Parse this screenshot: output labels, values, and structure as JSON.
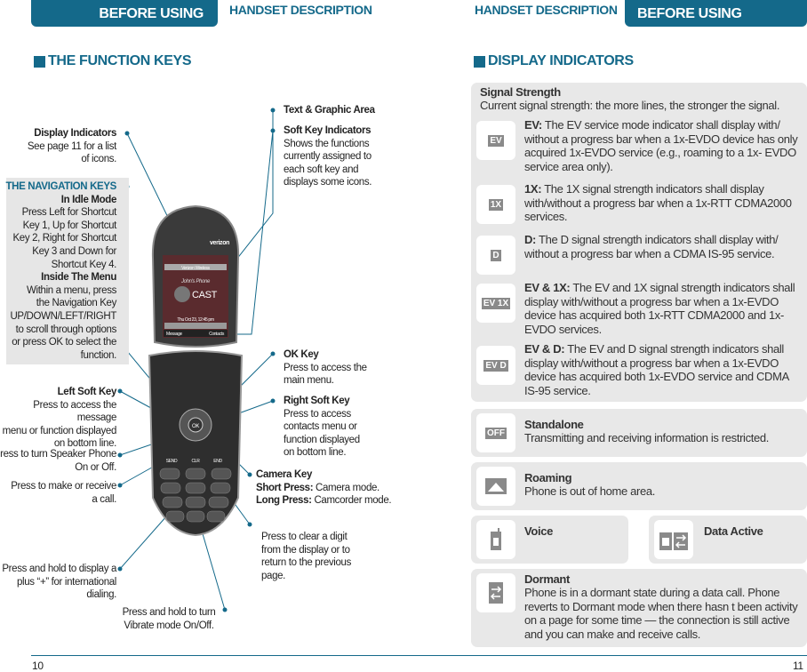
{
  "header": {
    "left_tab": "BEFORE USING",
    "left_section": "HANDSET DESCRIPTION",
    "right_section": "HANDSET DESCRIPTION",
    "right_tab": "BEFORE USING",
    "accent_color": "#14698a"
  },
  "left_page": {
    "title": "THE FUNCTION KEYS",
    "display_indicators": {
      "title": "Display Indicators",
      "lines": [
        "See page 11 for a list",
        "of icons."
      ]
    },
    "nav_keys": {
      "title": "THE NAVIGATION KEYS",
      "idle_title": "In Idle Mode",
      "idle_lines": [
        "Press Left for Shortcut",
        "Key 1, Up for Shortcut",
        "Key 2, Right for Shortcut",
        "Key 3 and Down for",
        "Shortcut Key 4."
      ],
      "menu_title": "Inside The Menu",
      "menu_lines": [
        "Within a menu, press",
        "the Navigation Key",
        "UP/DOWN/LEFT/RIGHT",
        "to scroll through options",
        "or press OK to select the",
        "function."
      ]
    },
    "left_soft_key": {
      "title": "Left Soft Key",
      "lines": [
        "Press to access the message",
        "menu or function displayed",
        "on bottom line."
      ]
    },
    "speaker": [
      "Press to turn Speaker Phone",
      "On or Off."
    ],
    "send": [
      "Press to make or receive",
      "a call."
    ],
    "plus": [
      "Press and hold to display a",
      "plus “+” for international",
      "dialing."
    ],
    "vibrate": [
      "Press and hold to turn",
      "Vibrate mode On/Off."
    ],
    "text_graphic": "Text & Graphic Area",
    "soft_key_indicators": {
      "title": "Soft Key Indicators",
      "lines": [
        "Shows the functions",
        "currently assigned to",
        "each soft key and",
        "displays some icons."
      ]
    },
    "ok_key": {
      "title": "OK Key",
      "lines": [
        "Press to access the",
        "main menu."
      ]
    },
    "right_soft_key": {
      "title": "Right Soft Key",
      "lines": [
        "Press to access",
        "contacts menu or",
        "function displayed",
        "on bottom line."
      ]
    },
    "camera_key": {
      "title": "Camera Key",
      "short_label": "Short Press:",
      "short_text": " Camera mode.",
      "long_label": "Long Press:",
      "long_text": " Camcorder mode."
    },
    "clear": [
      "Press to clear a digit",
      "from the display or to",
      "return to the previous",
      "page."
    ],
    "page_number": "10",
    "phone_screen": {
      "carrier": "verizon",
      "banner": "Verizon Wireless",
      "name": "John's Phone",
      "logo": "CAST",
      "datetime": "Thu Oct 23, 12:45 pm",
      "soft_left": "Message",
      "soft_mid": "MENU",
      "soft_right": "Contacts"
    },
    "keypad": {
      "send": "SEND",
      "clr": "CLR",
      "end": "END",
      "ok": "OK"
    }
  },
  "right_page": {
    "title": "DISPLAY INDICATORS",
    "signal": {
      "title": "Signal Strength",
      "text": "Current signal strength: the more lines, the stronger the signal.",
      "items": [
        {
          "icon": "EV",
          "label": "EV:",
          "text": " The EV service mode indicator shall display with/ without a progress bar when a 1x-EVDO device has only acquired 1x-EVDO service (e.g., roaming to a 1x- EVDO service area only)."
        },
        {
          "icon": "1X",
          "label": "1X:",
          "text": " The 1X signal strength indicators shall display with/without a progress bar when a 1x-RTT CDMA2000 services."
        },
        {
          "icon": "D",
          "label": "D:",
          "text": " The D signal strength indicators shall display with/ without a progress bar when a CDMA IS-95 service."
        },
        {
          "icon": "EV 1X",
          "label": "EV & 1X:",
          "text": " The EV and 1X signal strength indicators shall display with/without a progress bar when a 1x-EVDO device has acquired both 1x-RTT CDMA2000 and 1x- EVDO services."
        },
        {
          "icon": "EV D",
          "label": "EV & D:",
          "text": " The EV and D signal strength indicators shall display with/without a progress bar when a 1x-EVDO device has acquired both 1x-EVDO service and CDMA IS-95 service."
        }
      ]
    },
    "standalone": {
      "icon": "OFF",
      "title": "Standalone",
      "text": "Transmitting and receiving information is restricted."
    },
    "roaming": {
      "title": "Roaming",
      "text": "Phone is out of home area."
    },
    "voice": {
      "title": "Voice"
    },
    "data_active": {
      "title": "Data Active"
    },
    "dormant": {
      "title": "Dormant",
      "text": "Phone is in a dormant state during a data call. Phone reverts to Dormant mode when there hasn t been activity on a page for some time — the connection is still active and you can make and receive calls."
    },
    "page_number": "11"
  }
}
